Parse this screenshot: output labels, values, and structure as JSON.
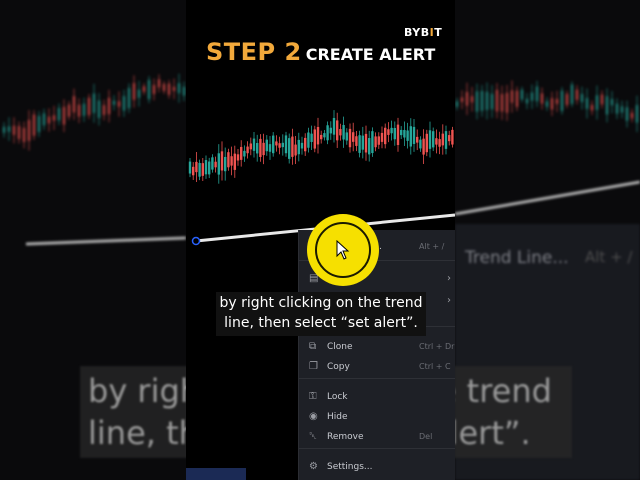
{
  "header": {
    "step_label": "STEP 2",
    "title": "CREATE ALERT",
    "brand_pre": "BYB",
    "brand_mark": "I",
    "brand_post": "T"
  },
  "context_menu": {
    "items": [
      {
        "label": "Trend Line...",
        "shortcut": "Alt + /",
        "icon": "trendline-icon"
      },
      {
        "label": "",
        "icon": "template-icon",
        "submenu": true
      },
      {
        "label": "",
        "icon": "visual-order-icon",
        "submenu": true
      },
      {
        "label": "Clone",
        "shortcut": "Ctrl + Drag",
        "icon": "clone-icon"
      },
      {
        "label": "Copy",
        "shortcut": "Ctrl + C",
        "icon": "copy-icon"
      },
      {
        "label": "Lock",
        "icon": "lock-icon"
      },
      {
        "label": "Hide",
        "icon": "hide-icon"
      },
      {
        "label": "Remove",
        "shortcut": "Del",
        "icon": "trash-icon"
      },
      {
        "label": "Settings...",
        "icon": "gear-icon"
      }
    ]
  },
  "caption": {
    "line1": "by right clicking on the trend",
    "line2": "line, then select “set alert”."
  },
  "background": {
    "big_caption_line1": "by right clicking on the trend",
    "big_caption_line2": "line, then select “set alert”.",
    "menu_title": "Trend Line...",
    "menu_shortcut": "Alt + /"
  },
  "colors": {
    "accent": "#f2a93b",
    "highlight": "#f6e000",
    "menu_bg": "#1e2026",
    "up_candle": "#26a69a",
    "down_candle": "#ef5350"
  }
}
